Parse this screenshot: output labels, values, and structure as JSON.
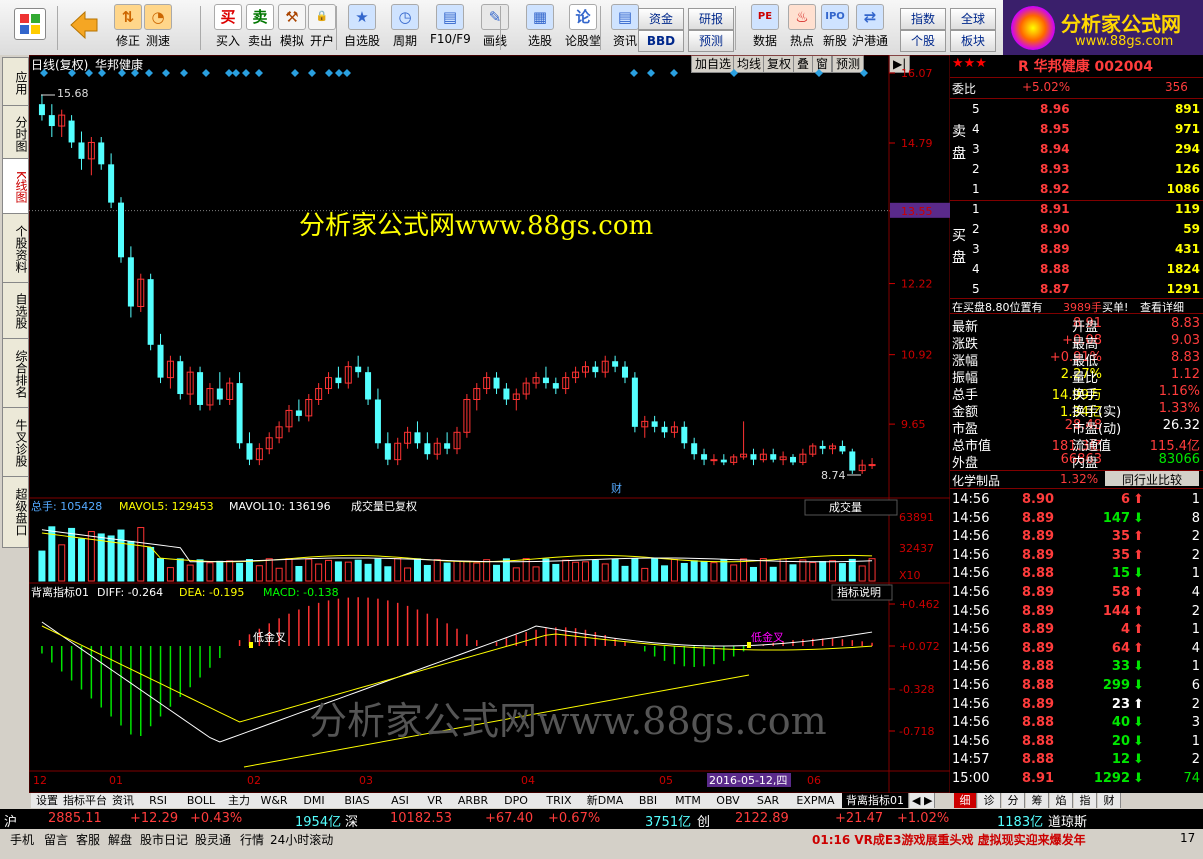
{
  "toolbar": {
    "buttons": [
      {
        "label": "修正",
        "icon": "up-down-arrows-icon"
      },
      {
        "label": "测速",
        "icon": "clock-icon"
      },
      {
        "label": "买入",
        "icon": "buy-icon"
      },
      {
        "label": "卖出",
        "icon": "sell-icon"
      },
      {
        "label": "模拟",
        "icon": "hammer-icon"
      },
      {
        "label": "开户",
        "icon": "lock-icon"
      },
      {
        "label": "自选股",
        "icon": "star-icon"
      },
      {
        "label": "周期",
        "icon": "clock-icon"
      },
      {
        "label": "F10/F9",
        "icon": "f10-icon"
      },
      {
        "label": "画线",
        "icon": "pen-icon"
      },
      {
        "label": "选股",
        "icon": "select-icon"
      },
      {
        "label": "论股堂",
        "icon": "discuss-icon"
      },
      {
        "label": "资讯",
        "icon": "news-icon"
      },
      {
        "label": "数据",
        "icon": "pe-icon"
      },
      {
        "label": "热点",
        "icon": "hot-icon"
      },
      {
        "label": "新股",
        "icon": "ipo-icon"
      },
      {
        "label": "沪港通",
        "icon": "sse-hkex-icon"
      }
    ],
    "small_buttons": [
      "资金",
      "研报",
      "BBD",
      "预测",
      "指数",
      "全球",
      "个股",
      "板块"
    ],
    "logo_title": "分析家公式网",
    "logo_url": "www.88gs.com"
  },
  "sidebar": [
    "应用",
    "分时图",
    "K线图",
    "个股资料",
    "自选股",
    "综合排名",
    "牛叉诊股",
    "超级盘口"
  ],
  "chart": {
    "period_label": "日线(复权)",
    "stock_name": "华邦健康",
    "controls": [
      "加自选",
      "均线",
      "复权",
      "叠",
      "窗",
      "预测"
    ],
    "watermark_top": "分析家公式网www.88gs.com",
    "watermark_bottom": "分析家公式网www.88gs.com",
    "price_axis": [
      "16.07",
      "14.79",
      "13.55",
      "12.22",
      "10.92",
      "9.65"
    ],
    "current_price_tag": "13.55",
    "high_label": "15.68",
    "low_label": "8.74",
    "cai_label": "财",
    "vol_header": {
      "total": "总手: 105428",
      "mavol5": "MAVOL5: 129453",
      "mavol10": "MAVOL10: 136196",
      "note": "成交量已复权",
      "btn": "成交量"
    },
    "vol_axis": [
      "63891",
      "32437",
      "X10"
    ],
    "macd_header": {
      "name": "背离指标01",
      "diff": "DIFF: -0.264",
      "dea": "DEA: -0.195",
      "macd": "MACD: -0.138",
      "btn": "指标说明"
    },
    "macd_axis": [
      "+0.462",
      "+0.072",
      "-0.328",
      "-0.718"
    ],
    "macd_labels": [
      "低金叉",
      "低金叉"
    ],
    "date_axis": [
      "12",
      "01",
      "02",
      "03",
      "04",
      "05",
      "2016-05-12,四",
      "06"
    ]
  },
  "chart_data": {
    "type": "candlestick",
    "title": "华邦健康 日线(复权)",
    "ylim": [
      8.5,
      16.07
    ],
    "y_ticks": [
      9.65,
      10.92,
      12.22,
      13.55,
      14.79,
      16.07
    ],
    "candles": [
      [
        15.5,
        15.68,
        15.2,
        15.3
      ],
      [
        15.3,
        15.5,
        14.9,
        15.1
      ],
      [
        15.1,
        15.4,
        14.9,
        15.3
      ],
      [
        15.2,
        15.3,
        14.7,
        14.8
      ],
      [
        14.8,
        15.0,
        14.3,
        14.5
      ],
      [
        14.5,
        14.9,
        14.2,
        14.8
      ],
      [
        14.8,
        14.9,
        14.3,
        14.4
      ],
      [
        14.4,
        14.6,
        13.6,
        13.7
      ],
      [
        13.7,
        13.8,
        12.6,
        12.7
      ],
      [
        12.7,
        12.9,
        11.6,
        11.8
      ],
      [
        11.8,
        12.4,
        11.7,
        12.3
      ],
      [
        12.3,
        12.4,
        11.0,
        11.1
      ],
      [
        11.1,
        11.3,
        10.4,
        10.5
      ],
      [
        10.5,
        10.9,
        10.3,
        10.8
      ],
      [
        10.8,
        10.9,
        10.1,
        10.2
      ],
      [
        10.2,
        10.7,
        10.0,
        10.6
      ],
      [
        10.6,
        10.7,
        9.9,
        10.0
      ],
      [
        10.0,
        10.4,
        9.9,
        10.3
      ],
      [
        10.3,
        10.6,
        10.0,
        10.1
      ],
      [
        10.1,
        10.5,
        10.0,
        10.4
      ],
      [
        10.4,
        10.6,
        9.2,
        9.3
      ],
      [
        9.3,
        9.5,
        8.9,
        9.0
      ],
      [
        9.0,
        9.3,
        8.9,
        9.2
      ],
      [
        9.2,
        9.5,
        9.1,
        9.4
      ],
      [
        9.4,
        9.7,
        9.3,
        9.6
      ],
      [
        9.6,
        10.0,
        9.5,
        9.9
      ],
      [
        9.9,
        10.1,
        9.7,
        9.8
      ],
      [
        9.8,
        10.2,
        9.7,
        10.1
      ],
      [
        10.1,
        10.4,
        10.0,
        10.3
      ],
      [
        10.3,
        10.6,
        10.2,
        10.5
      ],
      [
        10.5,
        10.7,
        10.3,
        10.4
      ],
      [
        10.4,
        10.8,
        10.3,
        10.7
      ],
      [
        10.7,
        10.9,
        10.5,
        10.6
      ],
      [
        10.6,
        10.7,
        10.0,
        10.1
      ],
      [
        10.1,
        10.3,
        9.2,
        9.3
      ],
      [
        9.3,
        9.5,
        8.9,
        9.0
      ],
      [
        9.0,
        9.4,
        8.9,
        9.3
      ],
      [
        9.3,
        9.6,
        9.2,
        9.5
      ],
      [
        9.5,
        9.7,
        9.2,
        9.3
      ],
      [
        9.3,
        9.5,
        9.0,
        9.1
      ],
      [
        9.1,
        9.4,
        9.0,
        9.3
      ],
      [
        9.3,
        9.5,
        9.1,
        9.2
      ],
      [
        9.2,
        9.6,
        9.1,
        9.5
      ],
      [
        9.5,
        10.2,
        9.4,
        10.1
      ],
      [
        10.1,
        10.4,
        9.9,
        10.3
      ],
      [
        10.3,
        10.6,
        10.2,
        10.5
      ],
      [
        10.5,
        10.6,
        10.2,
        10.3
      ],
      [
        10.3,
        10.4,
        10.0,
        10.1
      ],
      [
        10.1,
        10.3,
        9.9,
        10.2
      ],
      [
        10.2,
        10.5,
        10.1,
        10.4
      ],
      [
        10.4,
        10.6,
        10.3,
        10.5
      ],
      [
        10.5,
        10.7,
        10.3,
        10.4
      ],
      [
        10.4,
        10.5,
        10.2,
        10.3
      ],
      [
        10.3,
        10.6,
        10.2,
        10.5
      ],
      [
        10.5,
        10.7,
        10.4,
        10.6
      ],
      [
        10.6,
        10.8,
        10.5,
        10.7
      ],
      [
        10.7,
        10.8,
        10.5,
        10.6
      ],
      [
        10.6,
        10.9,
        10.5,
        10.8
      ],
      [
        10.8,
        10.9,
        10.6,
        10.7
      ],
      [
        10.7,
        10.8,
        10.4,
        10.5
      ],
      [
        10.5,
        10.6,
        9.5,
        9.6
      ],
      [
        9.6,
        9.8,
        9.4,
        9.7
      ],
      [
        9.7,
        9.8,
        9.5,
        9.6
      ],
      [
        9.6,
        9.7,
        9.4,
        9.5
      ],
      [
        9.5,
        9.7,
        9.4,
        9.6
      ],
      [
        9.6,
        9.7,
        9.2,
        9.3
      ],
      [
        9.3,
        9.4,
        9.0,
        9.1
      ],
      [
        9.1,
        9.2,
        8.9,
        9.0
      ],
      [
        9.0,
        9.1,
        8.9,
        9.0
      ],
      [
        9.0,
        9.1,
        8.9,
        8.95
      ],
      [
        8.95,
        9.1,
        8.9,
        9.05
      ],
      [
        9.05,
        9.7,
        9.0,
        9.1
      ],
      [
        9.1,
        9.2,
        8.9,
        9.0
      ],
      [
        9.0,
        9.2,
        8.95,
        9.1
      ],
      [
        9.1,
        9.2,
        8.95,
        9.0
      ],
      [
        9.0,
        9.15,
        8.9,
        9.05
      ],
      [
        9.05,
        9.1,
        8.9,
        8.95
      ],
      [
        8.95,
        9.2,
        8.9,
        9.1
      ],
      [
        9.1,
        9.3,
        9.05,
        9.25
      ],
      [
        9.25,
        9.35,
        9.1,
        9.2
      ],
      [
        9.2,
        9.3,
        9.1,
        9.25
      ],
      [
        9.25,
        9.35,
        9.1,
        9.15
      ],
      [
        9.15,
        9.2,
        8.74,
        8.8
      ],
      [
        8.8,
        9.0,
        8.74,
        8.9
      ],
      [
        8.9,
        9.03,
        8.83,
        8.91
      ]
    ],
    "dates_visible": [
      "12",
      "01",
      "02",
      "03",
      "04",
      "05",
      "2016-05-12,四",
      "06"
    ]
  },
  "right": {
    "stars": "★★★",
    "title": "R 华邦健康 002004",
    "weibi": {
      "label": "委比",
      "value": "+5.02%",
      "diff": "356"
    },
    "sell_label": "卖盘",
    "buy_label": "买盘",
    "sells": [
      {
        "n": "5",
        "price": "8.96",
        "vol": "891"
      },
      {
        "n": "4",
        "price": "8.95",
        "vol": "971"
      },
      {
        "n": "3",
        "price": "8.94",
        "vol": "294"
      },
      {
        "n": "2",
        "price": "8.93",
        "vol": "126"
      },
      {
        "n": "1",
        "price": "8.92",
        "vol": "1086"
      }
    ],
    "buys": [
      {
        "n": "1",
        "price": "8.91",
        "vol": "119"
      },
      {
        "n": "2",
        "price": "8.90",
        "vol": "59"
      },
      {
        "n": "3",
        "price": "8.89",
        "vol": "431"
      },
      {
        "n": "4",
        "price": "8.88",
        "vol": "1824"
      },
      {
        "n": "5",
        "price": "8.87",
        "vol": "1291"
      }
    ],
    "note": {
      "a": "在买盘8.80位置有",
      "b": "3989手",
      "c": "买单!",
      "d": "查看详细"
    },
    "stats": [
      [
        "最新",
        "8.91",
        "开盘",
        "8.83"
      ],
      [
        "涨跌",
        "+0.08",
        "最高",
        "9.03"
      ],
      [
        "涨幅",
        "+0.91%",
        "最低",
        "8.83"
      ],
      [
        "振幅",
        "2.27%",
        "量比",
        "1.12"
      ],
      [
        "总手",
        "14.99万",
        "换手",
        "1.16%"
      ],
      [
        "金额",
        "1.34亿",
        "换手(实)",
        "1.33%"
      ],
      [
        "市盈",
        "28.48",
        "市盈(动)",
        "26.32"
      ],
      [
        "总市值",
        "181.3亿",
        "流通值",
        "115.4亿"
      ],
      [
        "外盘",
        "66863",
        "内盘",
        "83066"
      ]
    ],
    "industry": {
      "name": "化学制品",
      "pct": "1.32%",
      "btn": "同行业比较"
    },
    "ticks": [
      [
        "14:56",
        "8.90",
        "6",
        "up",
        "1"
      ],
      [
        "14:56",
        "8.89",
        "147",
        "down",
        "8"
      ],
      [
        "14:56",
        "8.89",
        "35",
        "up",
        "2"
      ],
      [
        "14:56",
        "8.89",
        "35",
        "up",
        "2"
      ],
      [
        "14:56",
        "8.88",
        "15",
        "down",
        "1"
      ],
      [
        "14:56",
        "8.89",
        "58",
        "up",
        "4"
      ],
      [
        "14:56",
        "8.89",
        "144",
        "up",
        "2"
      ],
      [
        "14:56",
        "8.89",
        "4",
        "up",
        "1"
      ],
      [
        "14:56",
        "8.89",
        "64",
        "up",
        "4"
      ],
      [
        "14:56",
        "8.88",
        "33",
        "down",
        "1"
      ],
      [
        "14:56",
        "8.88",
        "299",
        "down",
        "6"
      ],
      [
        "14:56",
        "8.89",
        "23",
        "up-white",
        "2"
      ],
      [
        "14:56",
        "8.88",
        "40",
        "down",
        "3"
      ],
      [
        "14:56",
        "8.88",
        "20",
        "down",
        "1"
      ],
      [
        "14:57",
        "8.88",
        "12",
        "down",
        "2"
      ],
      [
        "15:00",
        "8.91",
        "1292",
        "down",
        "74"
      ]
    ],
    "tabs": [
      "细",
      "诊",
      "分",
      "筹",
      "焰",
      "指",
      "财"
    ]
  },
  "bottom_tabs": [
    "设置",
    "指标平台",
    "资讯",
    "RSI",
    "BOLL",
    "主力",
    "W&R",
    "DMI",
    "BIAS",
    "ASI",
    "VR",
    "ARBR",
    "DPO",
    "TRIX",
    "新DMA",
    "BBI",
    "MTM",
    "OBV",
    "SAR",
    "EXPMA",
    "背离指标01"
  ],
  "status": {
    "sh_label": "沪",
    "sh": "2885.11",
    "sh_chg": "+12.29",
    "sh_pct": "+0.43%",
    "sh_amt": "1954亿",
    "sz_label": "深",
    "sz": "10182.53",
    "sz_chg": "+67.40",
    "sz_pct": "+0.67%",
    "sz_amt": "3751亿",
    "cy_label": "创",
    "cy": "2122.89",
    "cy_chg": "+21.47",
    "cy_pct": "+1.02%",
    "cy_amt": "1183亿",
    "dj": "道琼斯"
  },
  "status2": {
    "items": [
      "手机",
      "留言",
      "客服",
      "解盘",
      "股市日记",
      "股灵通",
      "行情",
      "24小时滚动"
    ],
    "ticker": "01:16 VR成E3游戏展重头戏 虚拟现实迎来爆发年",
    "right": "17"
  }
}
